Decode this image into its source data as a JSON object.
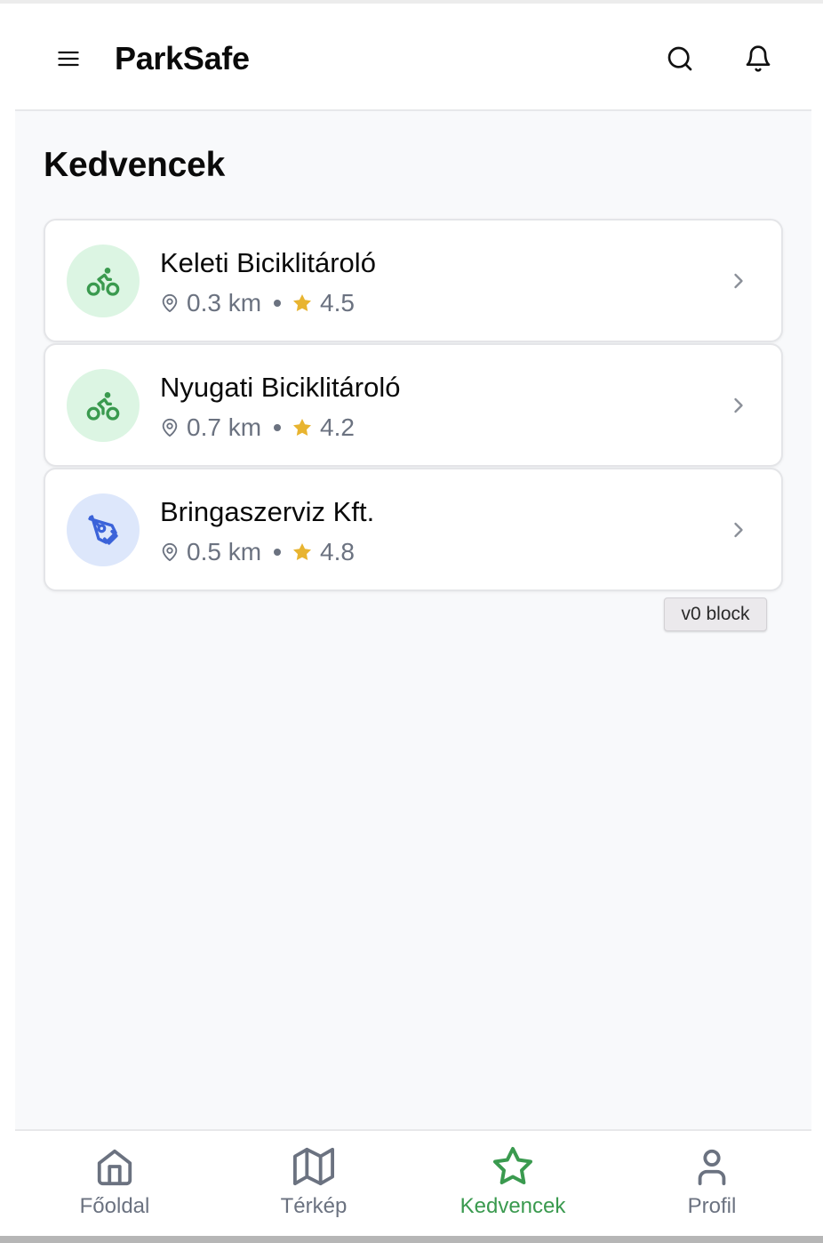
{
  "app": {
    "title": "ParkSafe"
  },
  "header": {
    "menu_icon": "menu-icon",
    "search_icon": "search-icon",
    "bell_icon": "bell-icon"
  },
  "page": {
    "title": "Kedvencek"
  },
  "favorites": [
    {
      "name": "Keleti Biciklitároló",
      "distance": "0.3 km",
      "rating": "4.5",
      "icon": "bike-icon",
      "icon_color": "#3a9a4f",
      "icon_bg": "#dcf5e3"
    },
    {
      "name": "Nyugati Biciklitároló",
      "distance": "0.7 km",
      "rating": "4.2",
      "icon": "bike-icon",
      "icon_color": "#3a9a4f",
      "icon_bg": "#dcf5e3"
    },
    {
      "name": "Bringaszerviz Kft.",
      "distance": "0.5 km",
      "rating": "4.8",
      "icon": "wrench-icon",
      "icon_color": "#3b63d9",
      "icon_bg": "#dde7fb"
    }
  ],
  "badge": {
    "label": "v0 block"
  },
  "nav": {
    "items": [
      {
        "label": "Főoldal",
        "icon": "home-icon",
        "active": false
      },
      {
        "label": "Térkép",
        "icon": "map-icon",
        "active": false
      },
      {
        "label": "Kedvencek",
        "icon": "star-icon",
        "active": true
      },
      {
        "label": "Profil",
        "icon": "user-icon",
        "active": false
      }
    ]
  },
  "colors": {
    "accent": "#3a9a4f",
    "star": "#e8b430",
    "muted_text": "#6b7280",
    "background": "#f8f9fb"
  }
}
